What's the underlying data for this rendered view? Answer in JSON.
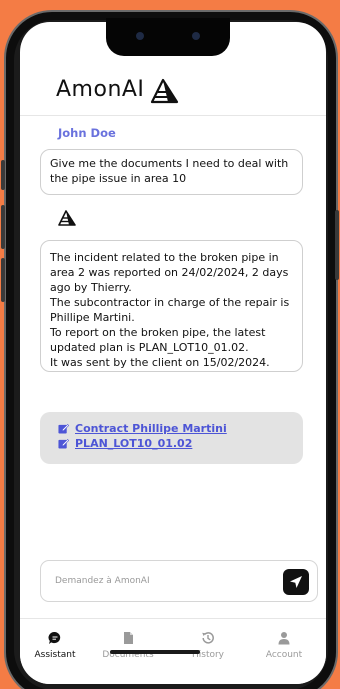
{
  "app": {
    "title": "AmonAI"
  },
  "chat": {
    "user_name": "John Doe",
    "question": "Give me the documents I need to deal with the pipe issue in area 10",
    "answer_lines": [
      "The incident related to the broken pipe in area 2 was reported on 24/02/2024, 2 days ago by Thierry.",
      "The subcontractor in charge of the repair is Phillipe Martini.",
      "To report on the broken pipe, the latest updated plan is PLAN_LOT10_01.02.",
      "It was sent by the client on 15/02/2024."
    ],
    "documents": [
      {
        "label": "Contract Phillipe Martini",
        "icon": "edit-document-icon"
      },
      {
        "label": "PLAN_LOT10_01.02",
        "icon": "edit-document-icon"
      }
    ]
  },
  "input": {
    "placeholder": "Demandez à AmonAI",
    "value": ""
  },
  "tabs": [
    {
      "label": "Assistant",
      "icon": "chat-bubble-icon",
      "active": true
    },
    {
      "label": "Documents",
      "icon": "document-icon",
      "active": false
    },
    {
      "label": "History",
      "icon": "history-icon",
      "active": false
    },
    {
      "label": "Account",
      "icon": "person-icon",
      "active": false
    }
  ],
  "colors": {
    "accent": "#6a72dd",
    "link": "#4d55d6",
    "background": "#f47c45"
  }
}
